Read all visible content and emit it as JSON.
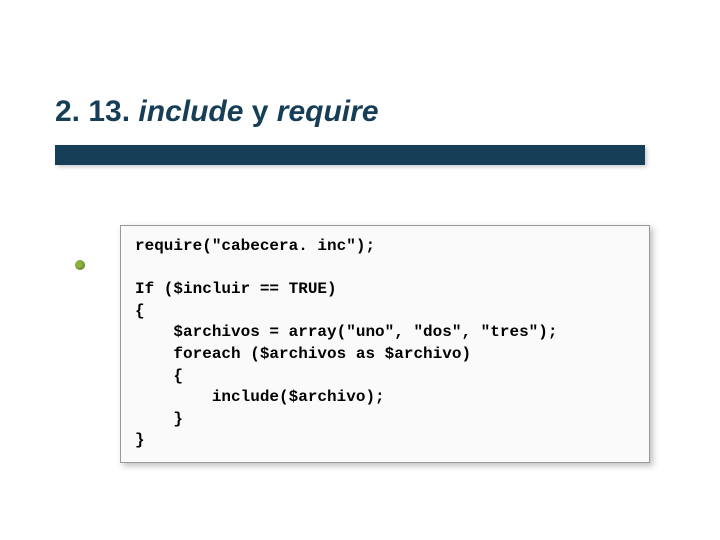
{
  "title": {
    "section_number": "2. 13.",
    "word_include": "include",
    "word_y": "y",
    "word_require": "require"
  },
  "code": {
    "line1": "require(\"cabecera. inc\");",
    "line2": "",
    "line3": "If ($incluir == TRUE)",
    "line4": "{",
    "line5": "    $archivos = array(\"uno\", \"dos\", \"tres\");",
    "line6": "    foreach ($archivos as $archivo)",
    "line7": "    {",
    "line8": "        include($archivo);",
    "line9": "    }",
    "line10": "}"
  }
}
